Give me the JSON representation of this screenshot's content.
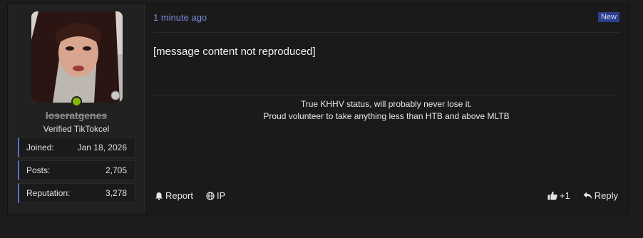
{
  "author": {
    "username": "loseratgenes",
    "user_title": "Verified TikTokcel",
    "online": true,
    "stats": [
      {
        "label": "Joined:",
        "value": "Jan 18, 2026"
      },
      {
        "label": "Posts:",
        "value": "2,705"
      },
      {
        "label": "Reputation:",
        "value": "3,278"
      }
    ]
  },
  "post": {
    "timestamp": "1 minute ago",
    "badge": "New",
    "body": [
      "[message content not reproduced]",
      ""
    ],
    "signature": [
      "True KHHV status, will probably never lose it.",
      "Proud volunteer to take anything less than HTB and above MLTB"
    ]
  },
  "actions": {
    "report": "Report",
    "ip": "IP",
    "like_count": "+1",
    "reply": "Reply"
  },
  "colors": {
    "accent": "#7b8bd9",
    "badge_bg": "#2c3e8c",
    "online": "#7fba00"
  }
}
